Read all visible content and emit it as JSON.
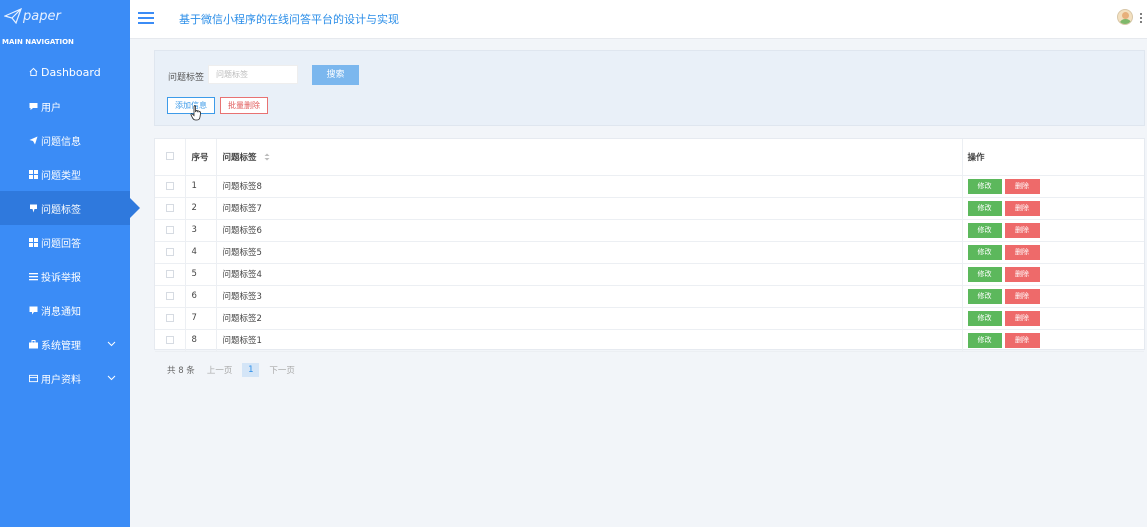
{
  "app": {
    "logo_text": "paper",
    "nav_header": "MAIN NAVIGATION",
    "site_title": "基于微信小程序的在线问答平台的设计与实现"
  },
  "sidebar": {
    "items": [
      {
        "label": "Dashboard",
        "icon": "home-icon"
      },
      {
        "label": "用户",
        "icon": "comment-icon"
      },
      {
        "label": "问题信息",
        "icon": "paper-plane-icon"
      },
      {
        "label": "问题类型",
        "icon": "grid-icon"
      },
      {
        "label": "问题标签",
        "icon": "tag-icon",
        "active": true
      },
      {
        "label": "问题回答",
        "icon": "grid-icon"
      },
      {
        "label": "投诉举报",
        "icon": "list-icon"
      },
      {
        "label": "消息通知",
        "icon": "message-icon"
      },
      {
        "label": "系统管理",
        "icon": "briefcase-icon",
        "expandable": true
      },
      {
        "label": "用户资料",
        "icon": "card-icon",
        "expandable": true
      }
    ]
  },
  "search": {
    "label": "问题标签",
    "placeholder": "问题标签",
    "button": "搜索"
  },
  "actions": {
    "add": "添加信息",
    "batch_delete": "批量删除"
  },
  "table": {
    "headers": {
      "index": "序号",
      "tag": "问题标签",
      "ops": "操作"
    },
    "rows": [
      {
        "index": "1",
        "tag": "问题标签8"
      },
      {
        "index": "2",
        "tag": "问题标签7"
      },
      {
        "index": "3",
        "tag": "问题标签6"
      },
      {
        "index": "4",
        "tag": "问题标签5"
      },
      {
        "index": "5",
        "tag": "问题标签4"
      },
      {
        "index": "6",
        "tag": "问题标签3"
      },
      {
        "index": "7",
        "tag": "问题标签2"
      },
      {
        "index": "8",
        "tag": "问题标签1"
      }
    ],
    "edit_label": "修改",
    "delete_label": "删除"
  },
  "pagination": {
    "total": "共 8 条",
    "prev": "上一页",
    "current": "1",
    "next": "下一页"
  },
  "colors": {
    "sidebar": "#3b8cf6",
    "sidebar_active": "#2f79dd",
    "edit": "#5cb85c",
    "delete": "#ee6a6a",
    "title": "#2b8ee8"
  }
}
